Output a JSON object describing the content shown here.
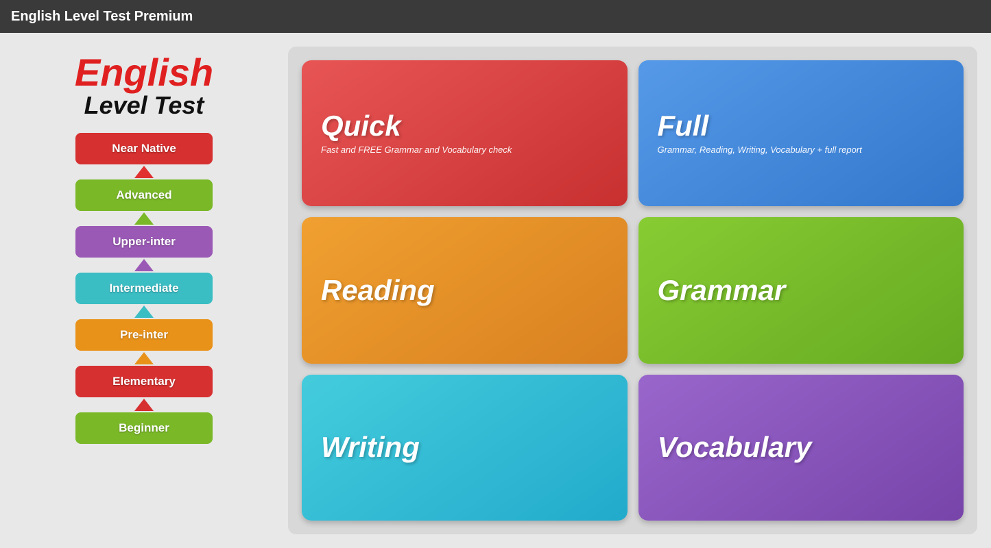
{
  "app": {
    "title": "English Level Test Premium"
  },
  "logo": {
    "english": "English",
    "level_test": "Level Test"
  },
  "levels": [
    {
      "id": "near-native",
      "label": "Near Native",
      "color": "#d63030"
    },
    {
      "id": "advanced",
      "label": "Advanced",
      "color": "#7ab828"
    },
    {
      "id": "upper-inter",
      "label": "Upper-inter",
      "color": "#9b59b6"
    },
    {
      "id": "intermediate",
      "label": "Intermediate",
      "color": "#3bbdc4"
    },
    {
      "id": "pre-inter",
      "label": "Pre-inter",
      "color": "#e8921a"
    },
    {
      "id": "elementary",
      "label": "Elementary",
      "color": "#d63030"
    },
    {
      "id": "beginner",
      "label": "Beginner",
      "color": "#7ab828"
    }
  ],
  "cards": [
    {
      "id": "quick",
      "title": "Quick",
      "subtitle": "Fast and FREE Grammar and Vocabulary check",
      "color_class": "card-quick"
    },
    {
      "id": "full",
      "title": "Full",
      "subtitle": "Grammar, Reading, Writing, Vocabulary + full report",
      "color_class": "card-full"
    },
    {
      "id": "reading",
      "title": "Reading",
      "subtitle": "",
      "color_class": "card-reading"
    },
    {
      "id": "grammar",
      "title": "Grammar",
      "subtitle": "",
      "color_class": "card-grammar"
    },
    {
      "id": "writing",
      "title": "Writing",
      "subtitle": "",
      "color_class": "card-writing"
    },
    {
      "id": "vocabulary",
      "title": "Vocabulary",
      "subtitle": "",
      "color_class": "card-vocabulary"
    }
  ],
  "arrows": [
    "arrow-up-red",
    "arrow-up-green",
    "arrow-up-purple",
    "arrow-up-teal",
    "arrow-up-orange",
    "arrow-up-red2"
  ]
}
